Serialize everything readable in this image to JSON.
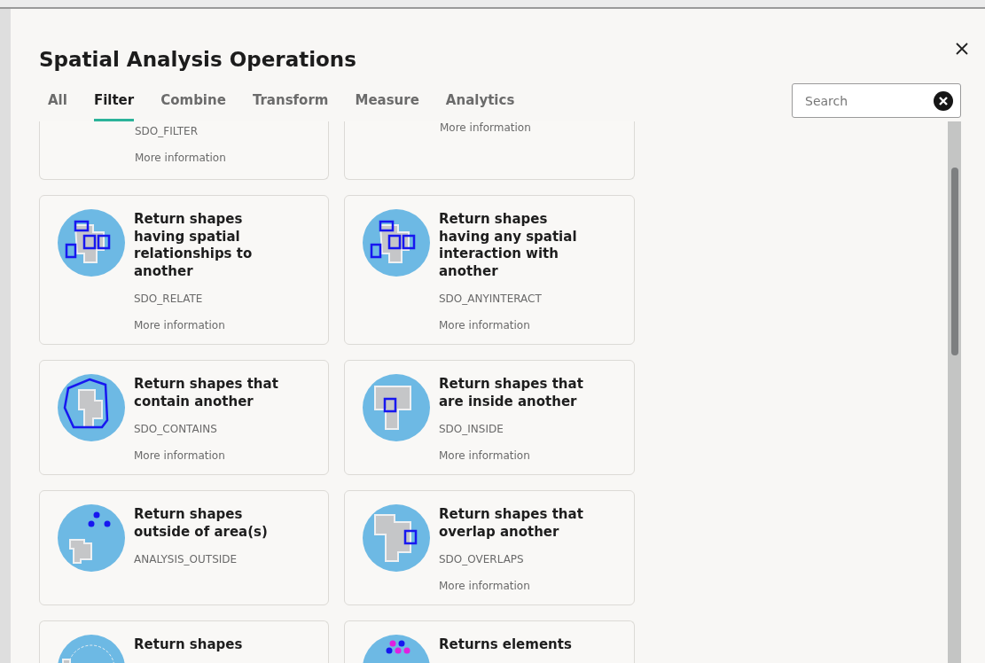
{
  "dialog": {
    "title": "Spatial Analysis Operations"
  },
  "tabs": [
    {
      "label": "All",
      "selected": false
    },
    {
      "label": "Filter",
      "selected": true
    },
    {
      "label": "Combine",
      "selected": false
    },
    {
      "label": "Transform",
      "selected": false
    },
    {
      "label": "Measure",
      "selected": false
    },
    {
      "label": "Analytics",
      "selected": false
    }
  ],
  "search": {
    "placeholder": "Search"
  },
  "cards": [
    {
      "code": "SDO_FILTER",
      "link": "More information"
    },
    {
      "link": "More information"
    },
    {
      "kind": "relate",
      "title": "Return shapes having spatial relationships to another",
      "code": "SDO_RELATE",
      "link": "More information"
    },
    {
      "kind": "anyinteract",
      "title": "Return shapes having any spatial interaction with another",
      "code": "SDO_ANYINTERACT",
      "link": "More information"
    },
    {
      "kind": "contains",
      "title": "Return shapes that contain another",
      "code": "SDO_CONTAINS",
      "link": "More information"
    },
    {
      "kind": "inside",
      "title": "Return shapes that are inside another",
      "code": "SDO_INSIDE",
      "link": "More information"
    },
    {
      "kind": "outside",
      "title": "Return shapes outside of area(s)",
      "code": "ANALYSIS_OUTSIDE"
    },
    {
      "kind": "overlaps",
      "title": "Return shapes that overlap another",
      "code": "SDO_OVERLAPS",
      "link": "More information"
    },
    {
      "kind": "within",
      "title": "Return shapes"
    },
    {
      "kind": "nonspatial",
      "title": "Returns elements"
    }
  ]
}
